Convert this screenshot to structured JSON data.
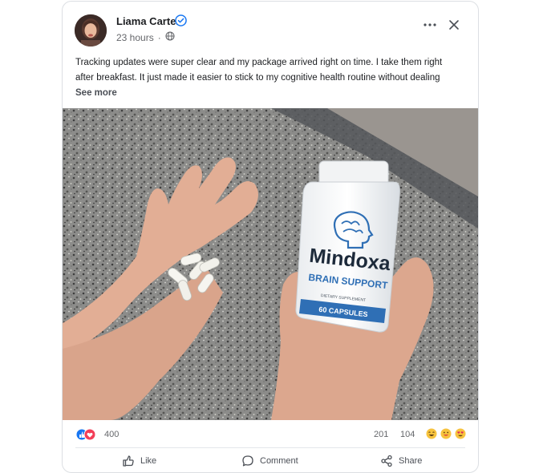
{
  "post": {
    "author": {
      "name": "Liama Carter",
      "verified": true
    },
    "timestamp": "23 hours",
    "separator": "·",
    "audience_icon": "globe-icon",
    "text_lines": [
      "Tracking updates were super clear and my package arrived right on time. I take them right",
      "after breakfast. It just made it easier to stick to my cognitive health routine without dealing"
    ],
    "see_more_label": "See more",
    "image": {
      "product_brand": "Mindoxa",
      "product_subtitle": "BRAIN SUPPORT",
      "product_label_small": "DIETARY SUPPLEMENT",
      "product_count": "60 CAPSULES"
    }
  },
  "stats": {
    "reactions_count": "400",
    "reaction_icons": [
      "like-icon",
      "love-icon"
    ],
    "comments_count": "201",
    "shares_count": "104",
    "emoji_icons": [
      "laugh-emoji-icon",
      "grin-emoji-icon",
      "heart-eyes-emoji-icon"
    ]
  },
  "actions": {
    "like_label": "Like",
    "comment_label": "Comment",
    "share_label": "Share"
  },
  "colors": {
    "verified_blue": "#1877f2",
    "like_blue": "#1877f2",
    "love_red": "#f33e58",
    "bottle_label_blue": "#2f6fb5"
  }
}
